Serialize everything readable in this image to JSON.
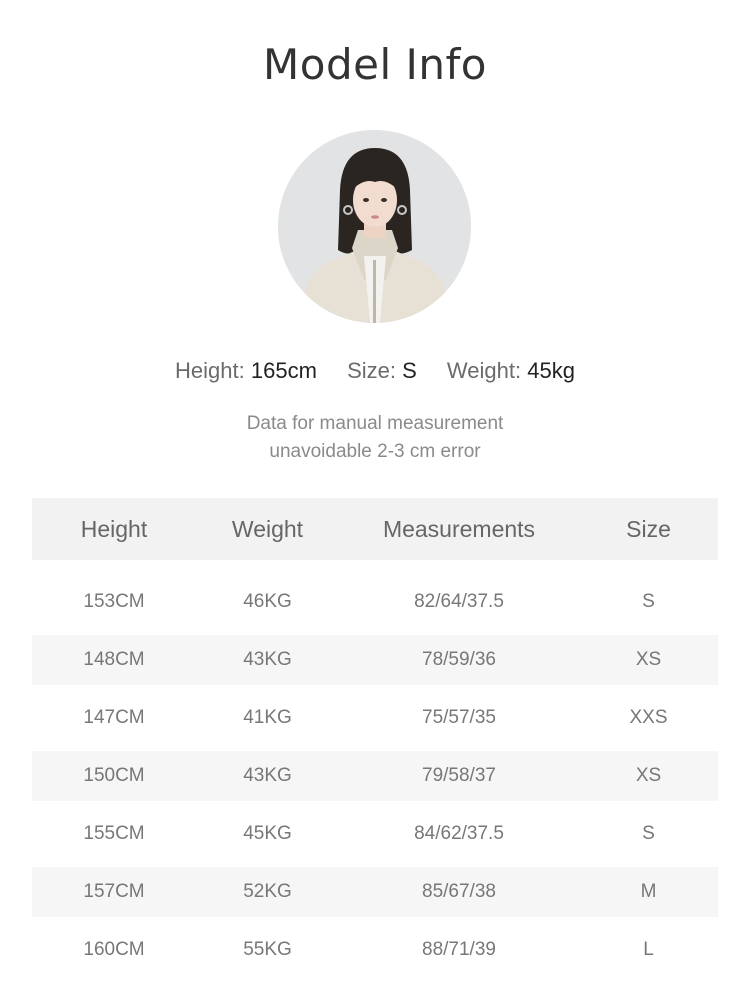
{
  "header": {
    "title": "Model Info"
  },
  "model": {
    "height_label": "Height:",
    "height_value": "165cm",
    "size_label": "Size:",
    "size_value": "S",
    "weight_label": "Weight:",
    "weight_value": "45kg"
  },
  "note": {
    "line1": "Data for manual measurement",
    "line2": "unavoidable 2-3 cm error"
  },
  "table": {
    "headers": [
      "Height",
      "Weight",
      "Measurements",
      "Size"
    ],
    "rows": [
      [
        "153CM",
        "46KG",
        "82/64/37.5",
        "S"
      ],
      [
        "148CM",
        "43KG",
        "78/59/36",
        "XS"
      ],
      [
        "147CM",
        "41KG",
        "75/57/35",
        "XXS"
      ],
      [
        "150CM",
        "43KG",
        "79/58/37",
        "XS"
      ],
      [
        "155CM",
        "45KG",
        "84/62/37.5",
        "S"
      ],
      [
        "157CM",
        "52KG",
        "85/67/38",
        "M"
      ],
      [
        "160CM",
        "55KG",
        "88/71/39",
        "L"
      ]
    ]
  },
  "colors": {
    "title": "#333333",
    "header_bg": "#f2f2f2",
    "row_alt_bg": "#f6f6f6"
  }
}
